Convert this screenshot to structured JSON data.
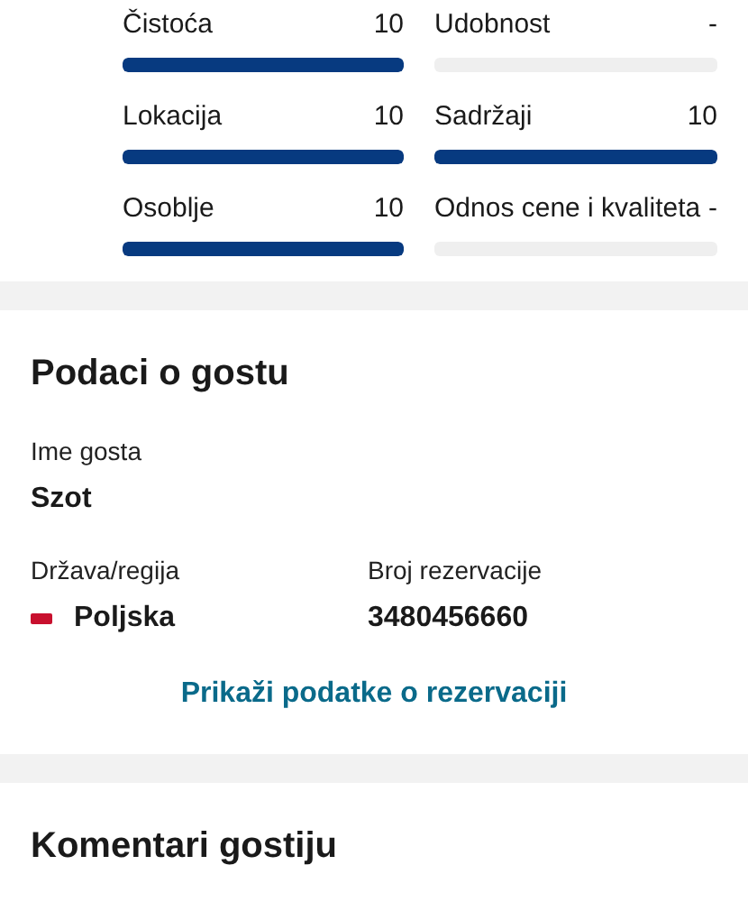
{
  "ratings": [
    {
      "label": "Čistoća",
      "score": "10",
      "level": 1
    },
    {
      "label": "Udobnost",
      "score": "-"
    },
    {
      "label": "Lokacija",
      "score": "10",
      "level": 1
    },
    {
      "label": "Sadržaji",
      "score": "10",
      "level": 1
    },
    {
      "label": "Osoblje",
      "score": "10",
      "level": 1
    },
    {
      "label": "Odnos cene i kvaliteta",
      "score": "-"
    }
  ],
  "guest_info": {
    "title": "Podaci o gostu",
    "name_label": "Ime gosta",
    "name": "Szot",
    "country_label": "Država/regija",
    "country": "Poljska",
    "booking_label": "Broj rezervacije",
    "booking_number": "3480456660",
    "link": "Prikaži podatke o rezervaciji"
  },
  "comments": {
    "title": "Komentari gostiju"
  }
}
